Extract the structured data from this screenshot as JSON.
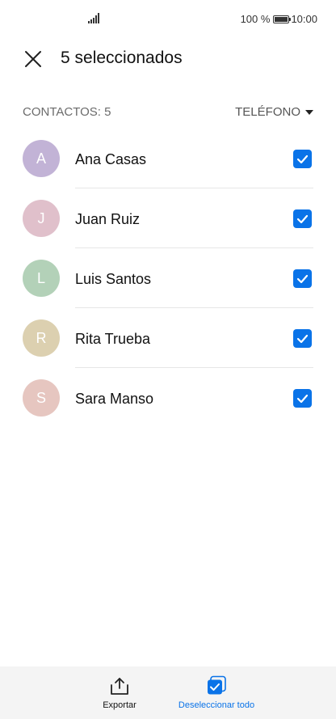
{
  "status_bar": {
    "battery": "100 %",
    "time": "10:00"
  },
  "header": {
    "title": "5 seleccionados"
  },
  "list_header": {
    "count_label": "CONTACTOS: 5",
    "filter_label": "TELÉFONO"
  },
  "contacts": [
    {
      "initial": "A",
      "name": "Ana Casas",
      "avatar_color": "#c2b3d6",
      "checked": true
    },
    {
      "initial": "J",
      "name": "Juan Ruiz",
      "avatar_color": "#e0c0cb",
      "checked": true
    },
    {
      "initial": "L",
      "name": "Luis Santos",
      "avatar_color": "#b3d1b8",
      "checked": true
    },
    {
      "initial": "R",
      "name": "Rita Trueba",
      "avatar_color": "#dcd0b0",
      "checked": true
    },
    {
      "initial": "S",
      "name": "Sara Manso",
      "avatar_color": "#e6c6c0",
      "checked": true
    }
  ],
  "bottom_bar": {
    "export_label": "Exportar",
    "deselect_label": "Deseleccionar todo"
  },
  "colors": {
    "accent": "#0a73e8"
  }
}
